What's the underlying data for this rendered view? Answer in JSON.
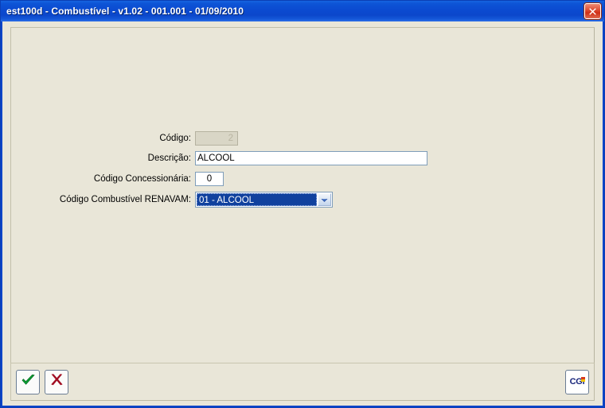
{
  "window": {
    "title": "est100d - Combustível - v1.02 - 001.001 - 01/09/2010",
    "close_label": "×",
    "close_icon": "close-icon",
    "accent_color": "#0b4ad0",
    "client_bg": "#e9e6d8"
  },
  "form": {
    "fields": [
      {
        "label": "Código:",
        "value": "2",
        "placeholder": "",
        "type": "text-disabled"
      },
      {
        "label": "Descrição:",
        "value": "ALCOOL",
        "placeholder": "",
        "type": "text"
      },
      {
        "label": "Código Concessionária:",
        "value": "0",
        "placeholder": "",
        "type": "number"
      },
      {
        "label": "Código Combustível RENAVAM:",
        "value": "01 - ALCOOL",
        "placeholder": "",
        "type": "combobox",
        "options": [
          "01 - ALCOOL"
        ]
      }
    ]
  },
  "toolbar": {
    "confirm_icon": "check-icon",
    "confirm_label": "✔",
    "cancel_icon": "x-icon",
    "cancel_label": "✖",
    "logo_text": "CG",
    "logo_suffix": "i",
    "logo_name": "cgi-logo"
  }
}
